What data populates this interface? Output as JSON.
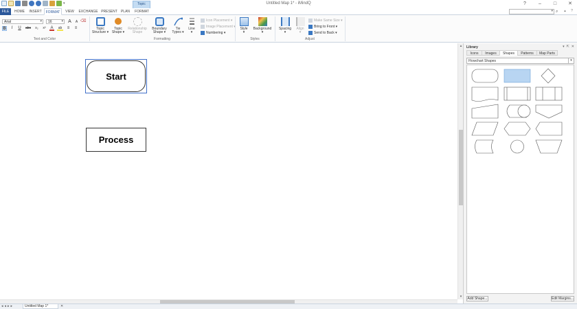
{
  "window": {
    "title": "Untitled Map 1* - iMindQ",
    "context_tab": "Topic",
    "controls": [
      "?",
      "–",
      "□",
      "✕"
    ]
  },
  "tabs": [
    {
      "label": "FILE",
      "kind": "file"
    },
    {
      "label": "HOME",
      "kind": "normal"
    },
    {
      "label": "INSERT",
      "kind": "normal"
    },
    {
      "label": "FORMAT",
      "kind": "active"
    },
    {
      "label": "VIEW",
      "kind": "normal"
    },
    {
      "label": "EXCHANGE",
      "kind": "normal"
    },
    {
      "label": "PRESENT",
      "kind": "normal"
    },
    {
      "label": "PLAN",
      "kind": "normal"
    },
    {
      "label": "FORMAT",
      "kind": "normal"
    }
  ],
  "ribbon": {
    "font_name": "Arial",
    "font_size": "16",
    "grow_font": "A",
    "shrink_font": "A",
    "format_buttons": [
      "B",
      "I",
      "U",
      "abc",
      "x₂",
      "x²",
      "A",
      "ab",
      "≡",
      "≡"
    ],
    "groups": {
      "text_color": "Text and Color",
      "formatting": "Formatting",
      "styles": "Styles",
      "adjust": "Adjust"
    },
    "formatting_buttons": [
      {
        "label": "Topic\nStructure ▾",
        "icon": "topic-structure-icon",
        "color": "#3a78c2",
        "disabled": false
      },
      {
        "label": "Topic\nShape ▾",
        "icon": "topic-shape-icon",
        "color": "#e08a25",
        "disabled": false
      },
      {
        "label": "Relationship\nShape",
        "icon": "relationship-shape-icon",
        "color": "#bbbbbb",
        "disabled": true
      },
      {
        "label": "Boundary\nShape ▾",
        "icon": "boundary-shape-icon",
        "color": "#3a78c2",
        "disabled": false
      },
      {
        "label": "Tie\nTypes ▾",
        "icon": "tie-types-icon",
        "color": "#3a78c2",
        "disabled": false
      },
      {
        "label": "Line\n▾",
        "icon": "line-icon",
        "color": "#666666",
        "disabled": false
      }
    ],
    "placement_buttons": [
      {
        "label": "Icon Placement ▾",
        "disabled": true
      },
      {
        "label": "Image Placement ▾",
        "disabled": true
      },
      {
        "label": "Numbering ▾",
        "disabled": false
      }
    ],
    "styles_buttons": [
      {
        "label": "Style\n▾",
        "icon": "style-icon",
        "color": "#3a78c2"
      },
      {
        "label": "Background\n▾",
        "icon": "background-icon",
        "color": "#c8352c"
      }
    ],
    "adjust_buttons": [
      {
        "label": "Spacing\n▾",
        "icon": "spacing-icon",
        "color": "#3a78c2",
        "disabled": false
      },
      {
        "label": "Align\n▾",
        "icon": "align-icon",
        "color": "#bbbbbb",
        "disabled": true
      }
    ],
    "arrange_buttons": [
      {
        "label": "Make Same Size ▾",
        "disabled": true
      },
      {
        "label": "Bring to Front ▾",
        "disabled": false
      },
      {
        "label": "Send to Back ▾",
        "disabled": false
      }
    ]
  },
  "canvas": {
    "nodes": [
      {
        "id": "start",
        "label": "Start"
      },
      {
        "id": "process",
        "label": "Process"
      }
    ]
  },
  "sheet": {
    "nav": [
      "◂",
      "◂",
      "▸",
      "▸"
    ],
    "tab_label": "Untitled Map 1*",
    "close": "✕"
  },
  "library": {
    "title": "Library",
    "controls": [
      "▾",
      "⇱",
      "✕"
    ],
    "tabs": [
      "Icons",
      "Images",
      "Shapes",
      "Patterns",
      "Map Parts"
    ],
    "active_tab": "Shapes",
    "category": "Flowchart Shapes",
    "selected_color": "#b8d5f2",
    "add_button": "Add Shape...",
    "edit_button": "Edit Margins..."
  }
}
